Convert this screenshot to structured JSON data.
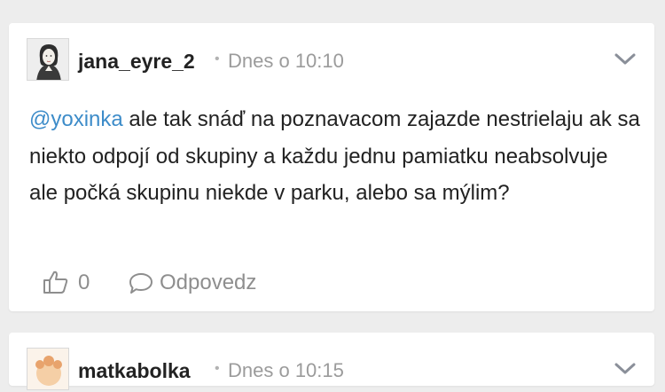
{
  "posts": [
    {
      "author": "jana_eyre_2",
      "separator": "•",
      "time": "Dnes o 10:10",
      "mention": "@yoxinka",
      "body": " ale tak snáď na poznavacom zajazde nestrielaju ak sa niekto odpojí od skupiny a každu jednu pamiatku neabsolvuje ale počká skupinu niekde v parku, alebo sa mýlim?",
      "likes": "0",
      "reply_label": "Odpovedz",
      "icons": {
        "avatar": "woman-sketch-avatar",
        "menu": "chevron-down-icon",
        "like": "thumbs-up-icon",
        "reply": "speech-bubble-icon"
      }
    },
    {
      "author": "matkabolka",
      "separator": "•",
      "time": "Dnes o 10:15",
      "icons": {
        "avatar": "baby-avatar",
        "menu": "chevron-down-icon"
      }
    }
  ],
  "colors": {
    "background": "#ededed",
    "card": "#ffffff",
    "mention": "#3d8cc9",
    "muted": "#8e8e8e"
  }
}
